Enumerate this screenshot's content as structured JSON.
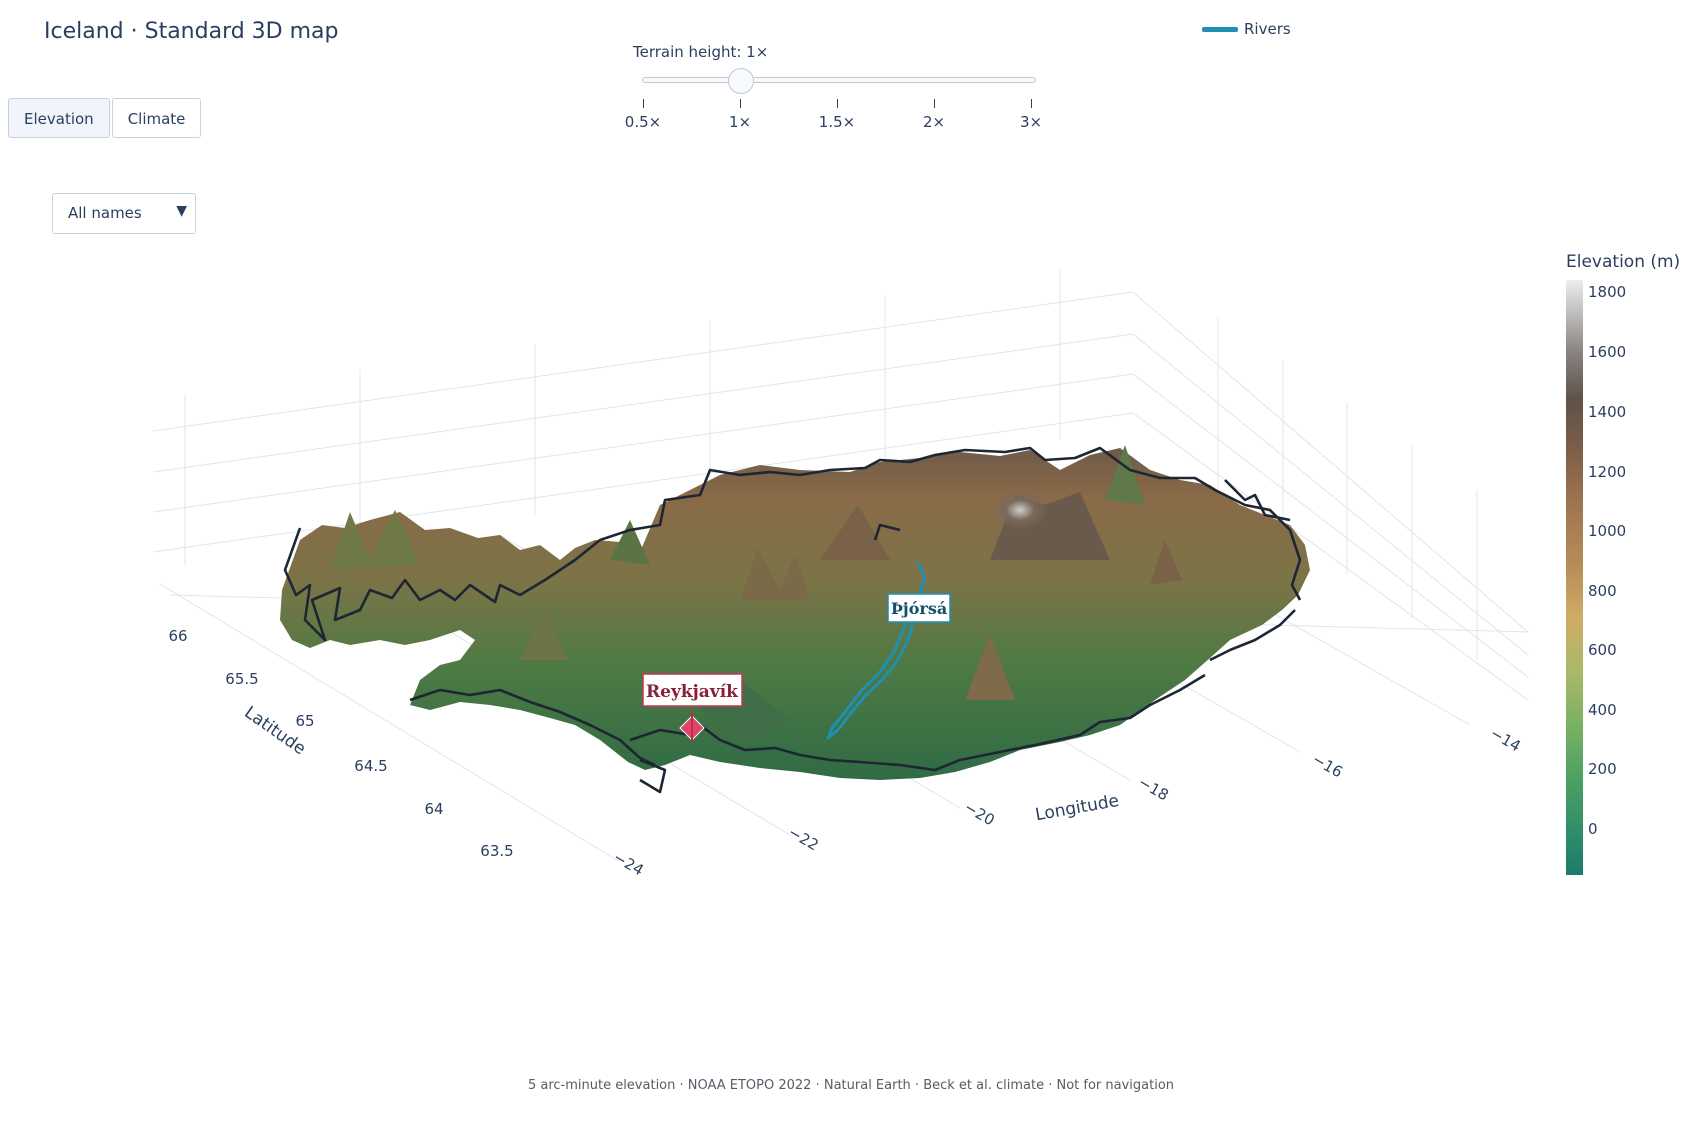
{
  "title": "Iceland · Standard 3D map",
  "buttons": [
    {
      "label": "Elevation",
      "active": true
    },
    {
      "label": "Climate",
      "active": false
    }
  ],
  "dropdown": {
    "selected": "All names"
  },
  "slider": {
    "label": "Terrain height: 1×",
    "value": "1×",
    "ticks": [
      "0.5×",
      "1×",
      "1.5×",
      "2×",
      "3×"
    ]
  },
  "legend": {
    "rivers": "Rivers",
    "rivers_color": "#1f8fb4"
  },
  "scene": {
    "latitude_label": "Latitude",
    "longitude_label": "Longitude",
    "latitude_ticks": [
      "66",
      "65.5",
      "65",
      "64.5",
      "64",
      "63.5"
    ],
    "longitude_ticks": [
      "−24",
      "−22",
      "−20",
      "−18",
      "−16",
      "−14"
    ],
    "annotations": {
      "city": "Reykjavík",
      "river": "Þjórsá"
    },
    "city_color": "#e0446a",
    "river_color": "#1f8fb4"
  },
  "colorbar": {
    "title": "Elevation (m)",
    "ticks": [
      "1800",
      "1600",
      "1400",
      "1200",
      "1000",
      "800",
      "600",
      "400",
      "200",
      "0"
    ]
  },
  "footer": "5 arc-minute elevation · NOAA ETOPO 2022 · Natural Earth · Beck et al. climate · Not for navigation"
}
